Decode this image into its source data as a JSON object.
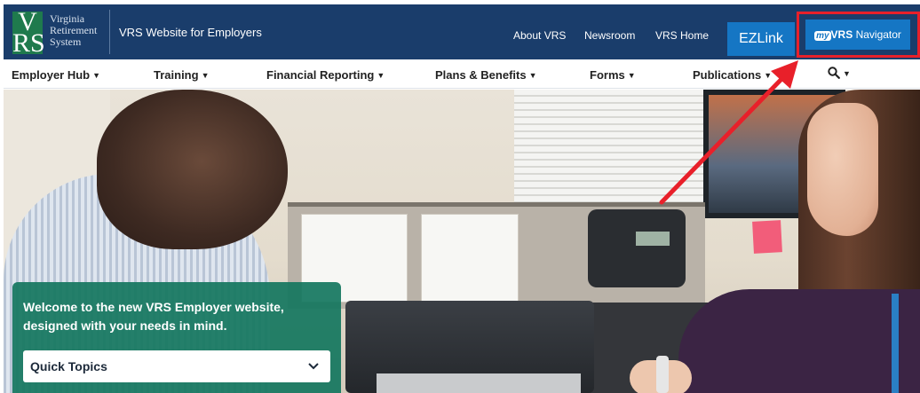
{
  "header": {
    "logo_lines": [
      "Virginia",
      "Retirement",
      "System"
    ],
    "logo_mark": "VRS",
    "site_title": "VRS Website for Employers",
    "links": [
      {
        "label": "About VRS"
      },
      {
        "label": "Newsroom"
      },
      {
        "label": "VRS Home"
      }
    ],
    "ezlink_label": "EZLink",
    "myvrs_prefix": "my",
    "myvrs_brand": "VRS",
    "myvrs_suffix": "Navigator",
    "highlight_color": "#e8202a"
  },
  "nav": {
    "items": [
      {
        "label": "Employer Hub"
      },
      {
        "label": "Training"
      },
      {
        "label": "Financial Reporting"
      },
      {
        "label": "Plans & Benefits"
      },
      {
        "label": "Forms"
      },
      {
        "label": "Publications"
      }
    ],
    "search_icon": "search-icon"
  },
  "welcome": {
    "message": "Welcome to the new VRS Employer website, designed with your needs in mind.",
    "quick_topics_label": "Quick Topics"
  },
  "colors": {
    "header_bg": "#1a3d6b",
    "button_blue": "#1576c4",
    "panel_green": "#14765e",
    "arrow_red": "#e8202a"
  }
}
